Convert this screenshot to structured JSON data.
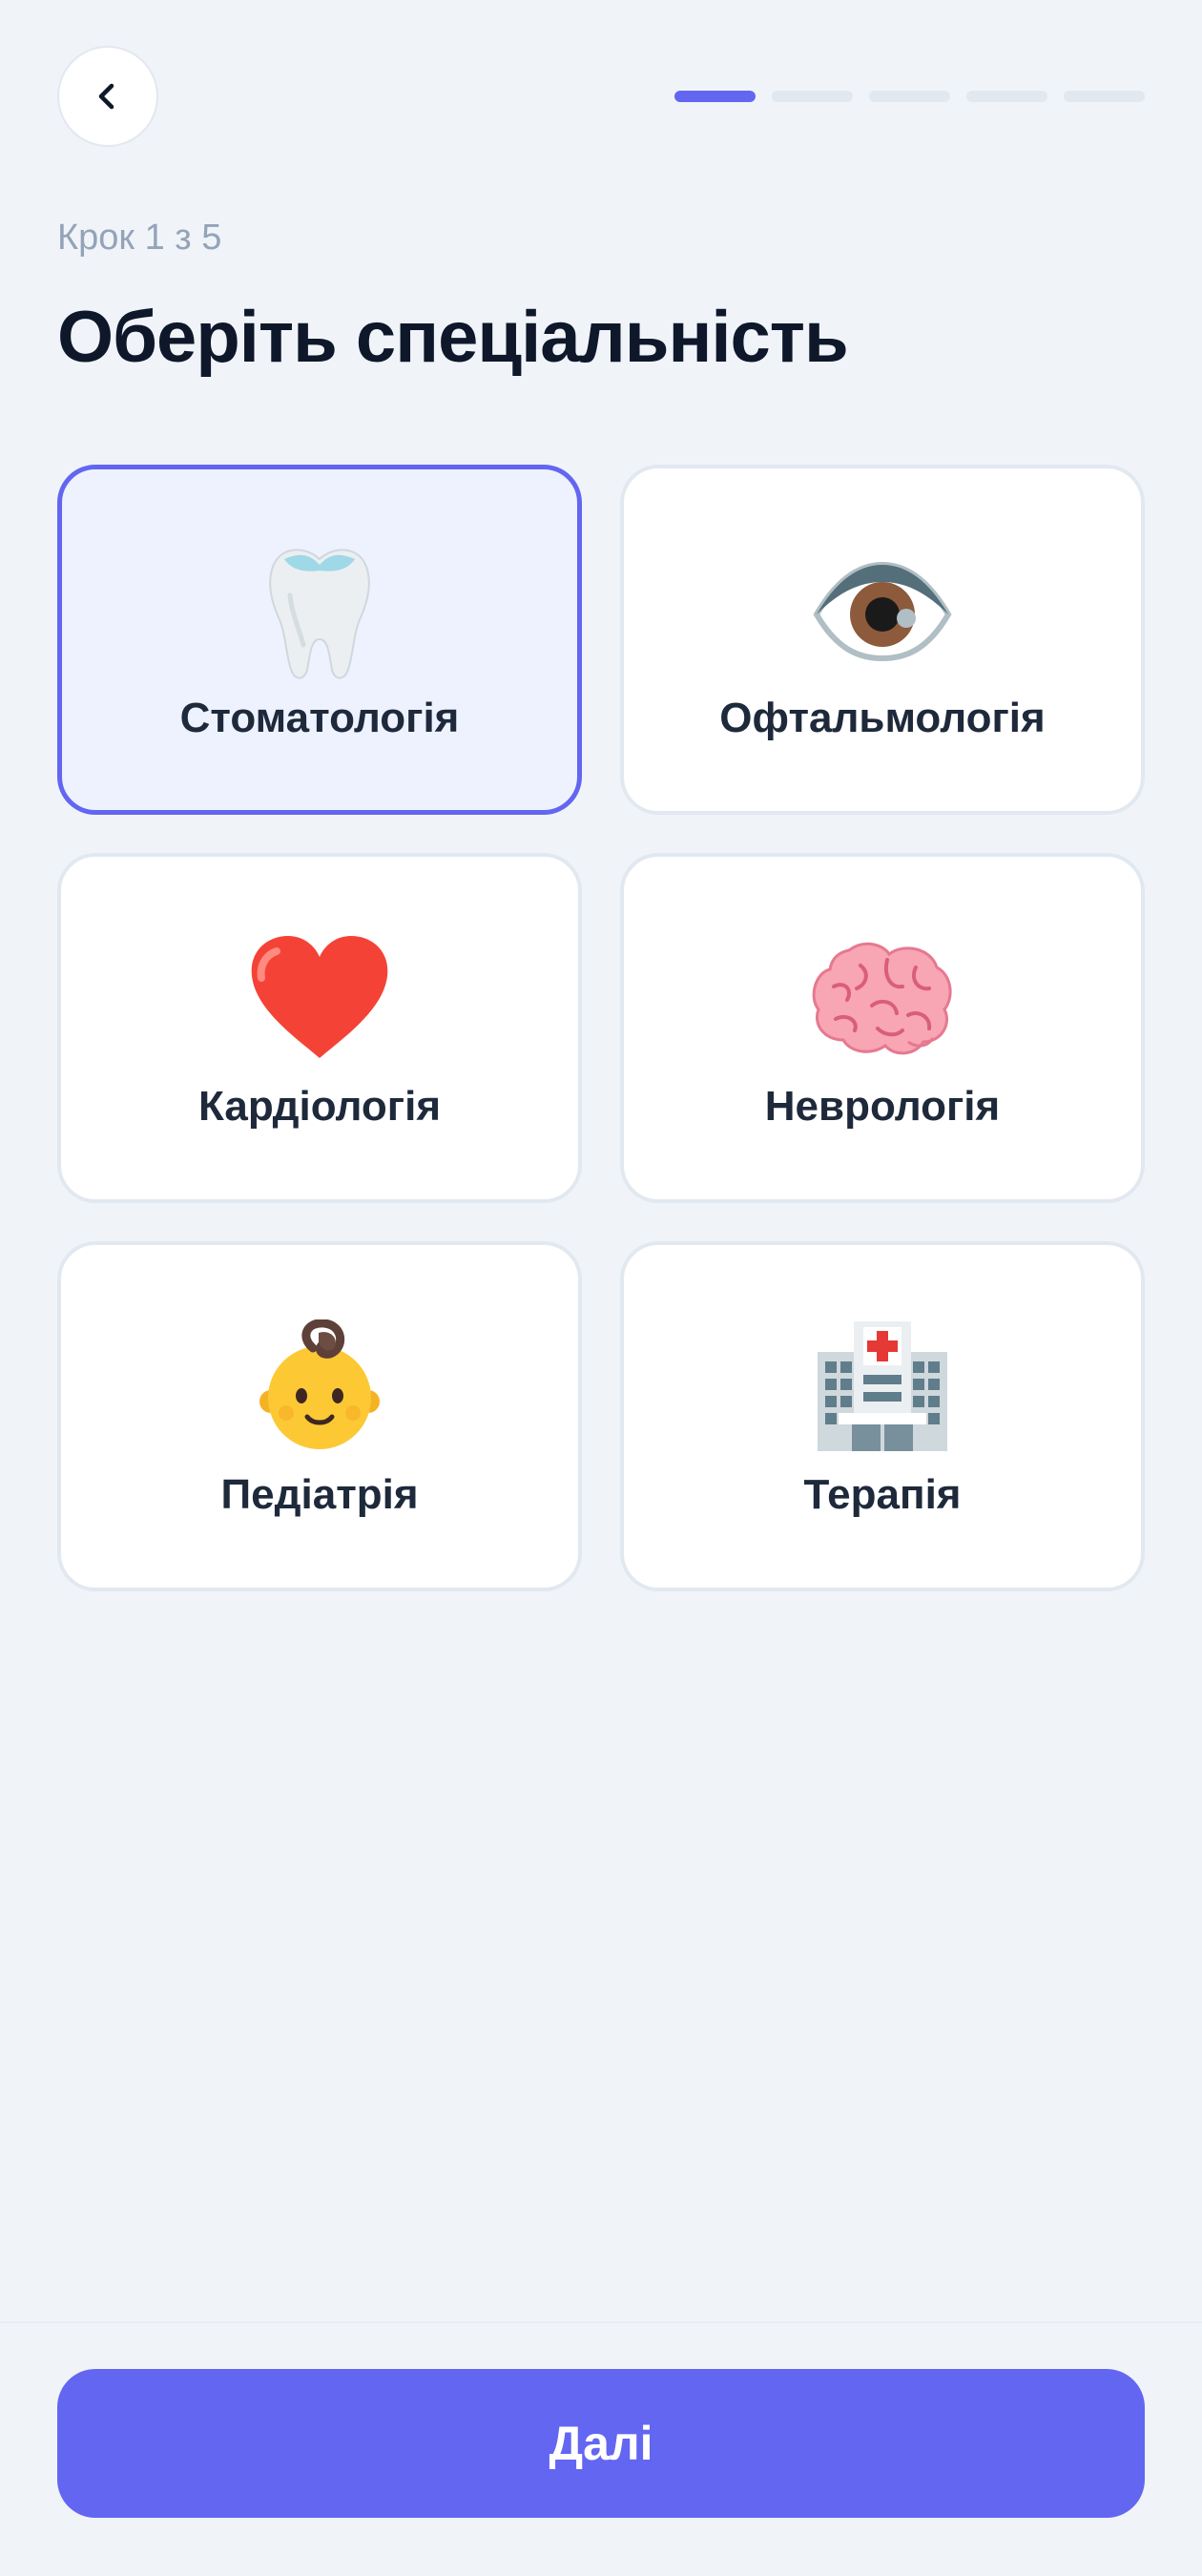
{
  "header": {
    "back_icon": "chevron-left-icon",
    "progress": {
      "total_steps": 5,
      "current_step": 1
    }
  },
  "step_label": "Крок 1 з 5",
  "title": "Оберіть спеціальність",
  "specialties": [
    {
      "label": "Стоматологія",
      "icon": "tooth-icon",
      "selected": true
    },
    {
      "label": "Офтальмологія",
      "icon": "eye-icon",
      "selected": false
    },
    {
      "label": "Кардіологія",
      "icon": "heart-icon",
      "selected": false
    },
    {
      "label": "Неврологія",
      "icon": "brain-icon",
      "selected": false
    },
    {
      "label": "Педіатрія",
      "icon": "baby-icon",
      "selected": false
    },
    {
      "label": "Терапія",
      "icon": "hospital-icon",
      "selected": false
    }
  ],
  "footer": {
    "next_label": "Далі"
  },
  "colors": {
    "accent": "#6366f1",
    "background": "#f0f4f9",
    "card_selected_bg": "#eef2ff",
    "card_border": "#e2e8f0",
    "text_primary": "#0f172a",
    "text_muted": "#94a3b8"
  }
}
